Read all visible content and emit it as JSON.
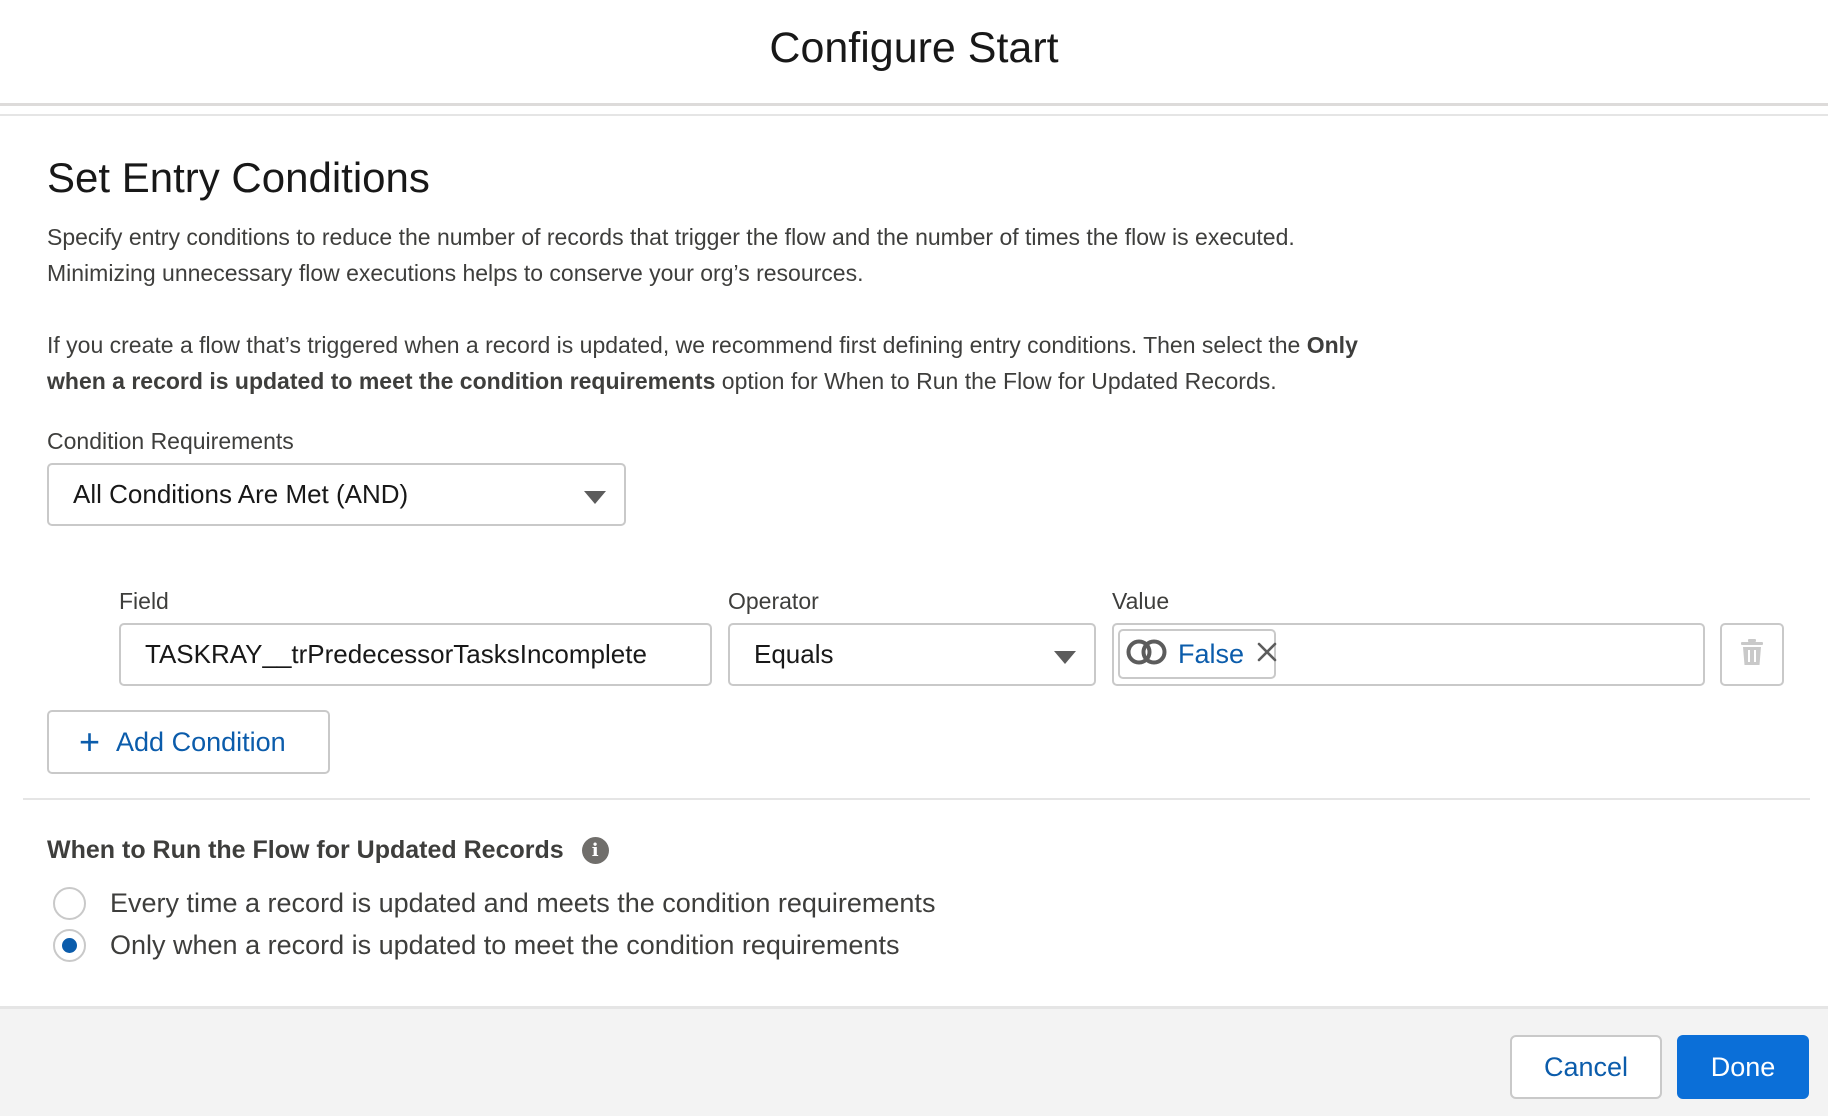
{
  "header": {
    "title": "Configure Start"
  },
  "section": {
    "title": "Set Entry Conditions",
    "description_line1": "Specify entry conditions to reduce the number of records that trigger the flow and the number of times the flow is executed.",
    "description_line2": "Minimizing unnecessary flow executions helps to conserve your org’s resources.",
    "recommend_prefix": "If you create a flow that’s triggered when a record is updated, we recommend first defining entry conditions. Then select the ",
    "recommend_bold1": "Only",
    "recommend_bold2": "when a record is updated to meet the condition requirements",
    "recommend_suffix": " option for When to Run the Flow for Updated Records."
  },
  "condition_requirements": {
    "label": "Condition Requirements",
    "selected": "All Conditions Are Met (AND)"
  },
  "condition": {
    "field_label": "Field",
    "field_value": "TASKRAY__trPredecessorTasksIncomplete",
    "operator_label": "Operator",
    "operator_value": "Equals",
    "value_label": "Value",
    "value_pill": "False",
    "value_icon": "boolean-toggle-icon",
    "delete_icon": "trash-icon"
  },
  "add_condition": {
    "label": "Add Condition",
    "icon": "plus-icon"
  },
  "when_to_run": {
    "title": "When to Run the Flow for Updated Records",
    "info_icon": "info-icon",
    "options": [
      {
        "label": "Every time a record is updated and meets the condition requirements",
        "checked": false
      },
      {
        "label": "Only when a record is updated to meet the condition requirements",
        "checked": true
      }
    ]
  },
  "footer": {
    "cancel_label": "Cancel",
    "done_label": "Done"
  },
  "colors": {
    "brand_blue": "#0b5cab",
    "done_blue": "#0b6fd8",
    "border": "#c9c9c9"
  }
}
